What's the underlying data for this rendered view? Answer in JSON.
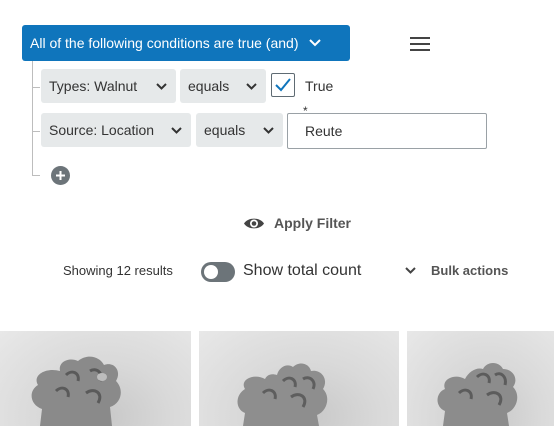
{
  "filter": {
    "group_label": "All of the following conditions are true (and)",
    "conditions": [
      {
        "field": "Types: Walnut",
        "operator": "equals",
        "value_label": "True",
        "checked": true
      },
      {
        "field": "Source: Location",
        "operator": "equals",
        "required_mark": "*",
        "value": "Reute"
      }
    ],
    "apply_label": "Apply Filter"
  },
  "results": {
    "count_label": "Showing 12 results",
    "toggle_label": "Show total count",
    "toggle_on": false,
    "bulk_label": "Bulk actions"
  },
  "thumbnails": [
    {
      "alt": "walnut"
    },
    {
      "alt": "walnut"
    },
    {
      "alt": "walnut"
    }
  ],
  "colors": {
    "accent": "#0f75bc",
    "chip": "#e6e9ea",
    "icon": "#6c7479"
  }
}
